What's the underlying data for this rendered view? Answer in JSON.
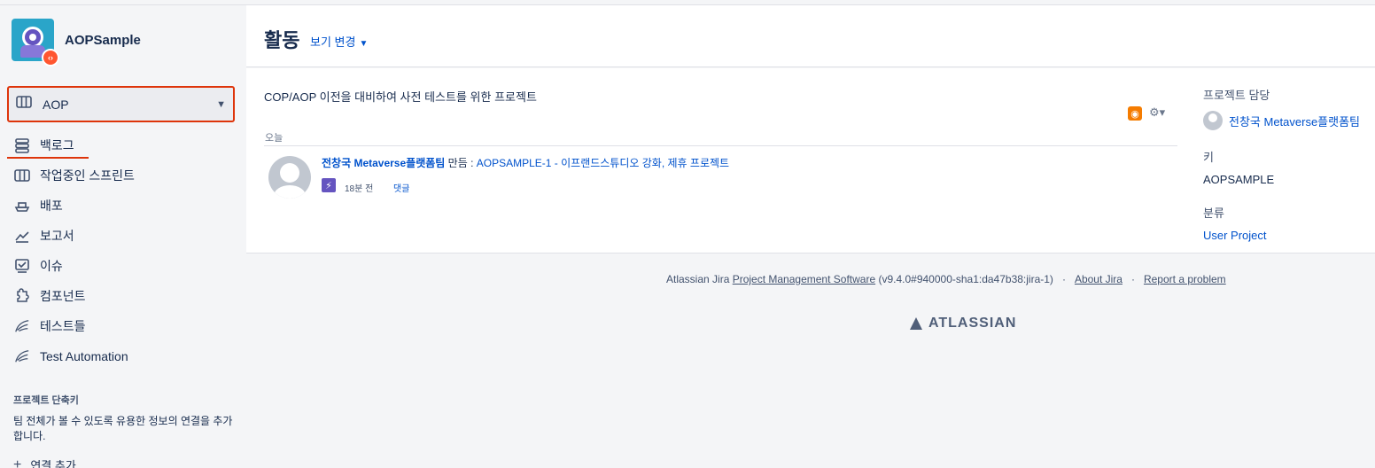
{
  "project": {
    "name": "AOPSample",
    "badge": "‹›"
  },
  "board_select": {
    "label": "AOP"
  },
  "nav": [
    {
      "key": "backlog",
      "label": "백로그",
      "icon": "backlog-icon",
      "glyph": "☰"
    },
    {
      "key": "sprint",
      "label": "작업중인 스프린트",
      "icon": "board-icon",
      "glyph": "▥"
    },
    {
      "key": "release",
      "label": "배포",
      "icon": "ship-icon",
      "glyph": "⛴"
    },
    {
      "key": "reports",
      "label": "보고서",
      "icon": "chart-icon",
      "glyph": "↗"
    },
    {
      "key": "issues",
      "label": "이슈",
      "icon": "issues-icon",
      "glyph": "☑"
    },
    {
      "key": "components",
      "label": "컴포넌트",
      "icon": "puzzle-icon",
      "glyph": "✿"
    },
    {
      "key": "tests",
      "label": "테스트들",
      "icon": "wing-icon",
      "glyph": "≋"
    },
    {
      "key": "automation",
      "label": "Test Automation",
      "icon": "wing-icon",
      "glyph": "≋"
    }
  ],
  "shortcuts": {
    "title": "프로젝트 단축키",
    "description": "팀 전체가 볼 수 있도록 유용한 정보의 연결을 추가합니다.",
    "add_label": "연결 추가"
  },
  "header": {
    "title": "활동",
    "view_change": "보기 변경"
  },
  "activity": {
    "description": "COP/AOP 이전을 대비하여 사전 테스트를 위한 프로젝트",
    "group_label": "오늘",
    "user": "전창국 Metaverse플랫폼팀",
    "verb": " 만듬 : ",
    "link": "AOPSAMPLE-1 - 이프랜드스튜디오 강화, 제휴 프로젝트",
    "time": "18분 전",
    "comment": "댓글"
  },
  "info": {
    "lead_label": "프로젝트 담당",
    "lead_name": "전창국 Metaverse플랫폼팀",
    "key_label": "키",
    "key_value": "AOPSAMPLE",
    "category_label": "분류",
    "category_value": "User Project"
  },
  "footer": {
    "prefix": "Atlassian Jira ",
    "pms": "Project Management Software",
    "version": " (v9.4.0#940000-sha1:da47b38:jira-1)",
    "about": "About Jira",
    "report": "Report a problem",
    "brand": "ATLASSIAN"
  },
  "colors": {
    "accent": "#0052cc",
    "highlight": "#de350b",
    "rss": "#f57c00",
    "bolt": "#6554c0"
  }
}
